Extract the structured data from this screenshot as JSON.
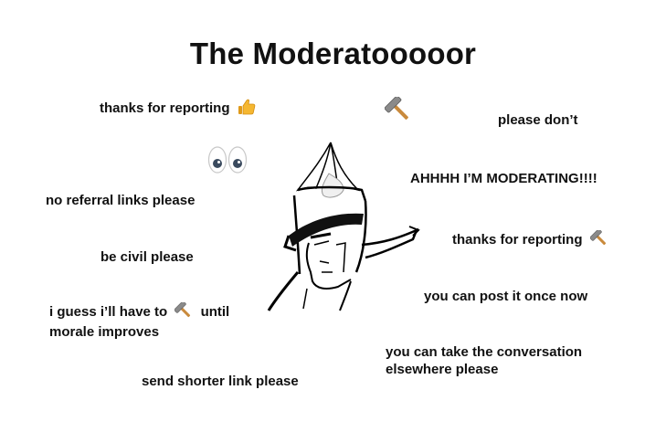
{
  "title": "The Moderatooooor",
  "phrases": {
    "thanks_reporting_1": "thanks for reporting",
    "please_dont": "please don’t",
    "ahhhh": "AHHHH I’M MODERATING!!!!",
    "no_referral": "no referral links please",
    "thanks_reporting_2": "thanks for reporting",
    "be_civil": "be civil please",
    "post_once": "you can post it once now",
    "guess_line1_before": "i guess i’ll have to",
    "guess_line1_after": "until",
    "guess_line2": "morale improves",
    "take_conversation": "you can take the conversation elsewhere please",
    "shorter_link": "send shorter link please"
  },
  "icons": {
    "thumbs_up": "thumbs-up-emoji",
    "hammer": "hammer-emoji",
    "eyes": "eyes-emoji",
    "figure": "moderator-knight-drawing"
  },
  "colors": {
    "text": "#111111",
    "thumb": "#f5b731",
    "hammer_head": "#8a8a8a",
    "hammer_handle": "#c98a3c"
  }
}
